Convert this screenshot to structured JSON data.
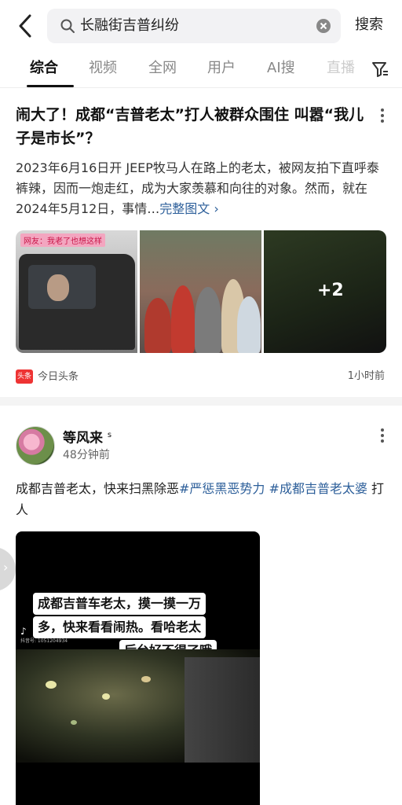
{
  "search": {
    "query": "长融街吉普纠纷",
    "button_label": "搜索"
  },
  "tabs": [
    {
      "label": "综合"
    },
    {
      "label": "视频"
    },
    {
      "label": "全网"
    },
    {
      "label": "用户"
    },
    {
      "label": "AI搜"
    },
    {
      "label": "直播"
    }
  ],
  "article": {
    "title": "闹大了！成都“吉普老太”打人被群众围住 叫嚣“我儿子是市长”？",
    "body": "2023年6月16日开 JEEP牧马人在路上的老太，被网友拍下直呼泰裤辣，因而一炮走红，成为大家羡慕和向往的对象。然而，就在2024年5月12日，事情…",
    "link_label": "完整图文 ›",
    "thumb1_tag": "网友：我老了也想这样",
    "more_count": "+2",
    "source_logo": "头条",
    "source_name": "今日头条",
    "time": "1小时前"
  },
  "post": {
    "username": "等风来",
    "badge": "s",
    "time": "48分钟前",
    "text_plain": "成都吉普老太，快来扫黑除恶",
    "hashtag1": "#严惩黑恶势力",
    "hashtag2": "#成都吉普老太婆",
    "text_tail": " 打人",
    "video_caption_1": "成都吉普车老太，摸一摸一万",
    "video_caption_2": "多，快来看看闹热。看哈老太",
    "video_caption_3": "后台好不得了哦",
    "tiktok_label": "抖音",
    "tiktok_id": "抖音号: 1051204934",
    "side_arrow": "›"
  }
}
